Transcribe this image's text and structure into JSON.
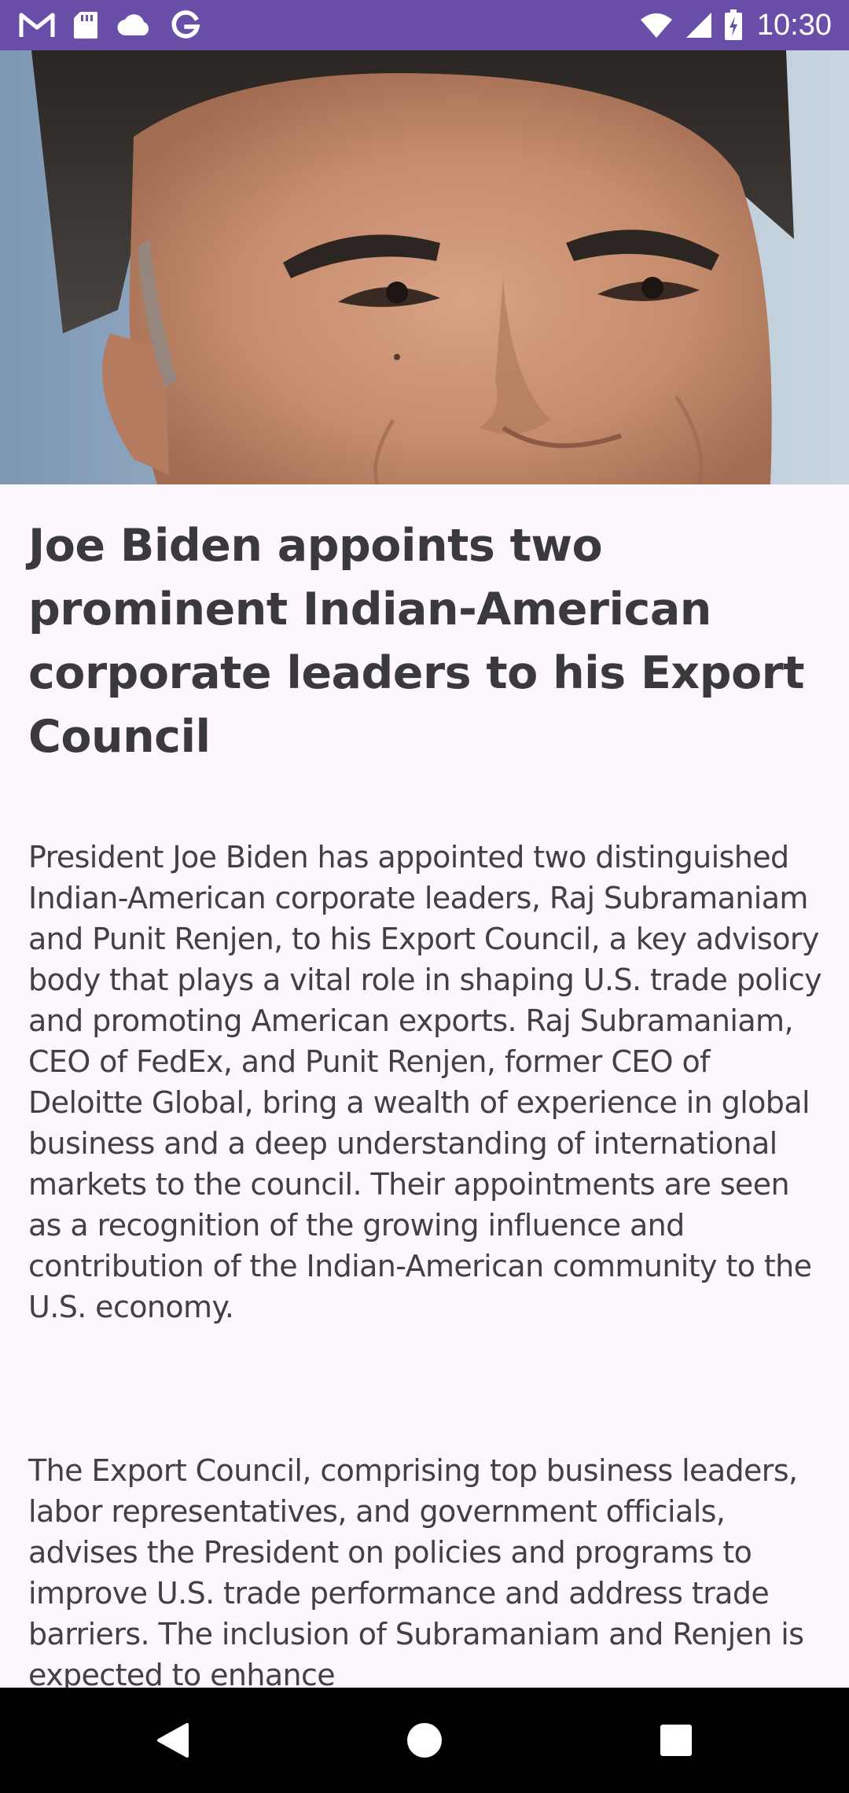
{
  "status_bar": {
    "time": "10:30",
    "left_icons": [
      "gmail-icon",
      "sd-card-icon",
      "cloud-icon",
      "google-icon"
    ],
    "right_icons": [
      "wifi-icon",
      "cell-signal-icon",
      "battery-charging-icon"
    ],
    "background": "#6A4FA8"
  },
  "hero": {
    "image": "portrait-photo"
  },
  "article": {
    "title": "Joe Biden appoints two prominent Indian-American corporate leaders to his Export Council",
    "paragraphs": [
      "President Joe Biden has appointed two distinguished Indian-American corporate leaders, Raj Subramaniam and Punit Renjen, to his Export Council, a key advisory body that plays a vital role in shaping U.S. trade policy and promoting American exports. Raj Subramaniam, CEO of FedEx, and Punit Renjen, former CEO of Deloitte Global, bring a wealth of experience in global business and a deep understanding of international markets to the council. Their appointments are seen as a recognition of the growing influence and contribution of the Indian-American community to the U.S. economy.",
      "The Export Council, comprising top business leaders, labor representatives, and government officials, advises the President on policies and programs to improve U.S. trade performance and address trade barriers. The inclusion of Subramaniam and Renjen is expected to enhance"
    ],
    "text_color": "#414145",
    "background": "#FDF7FD"
  },
  "nav_bar": {
    "buttons": [
      "back-icon",
      "home-icon",
      "recents-icon"
    ]
  }
}
